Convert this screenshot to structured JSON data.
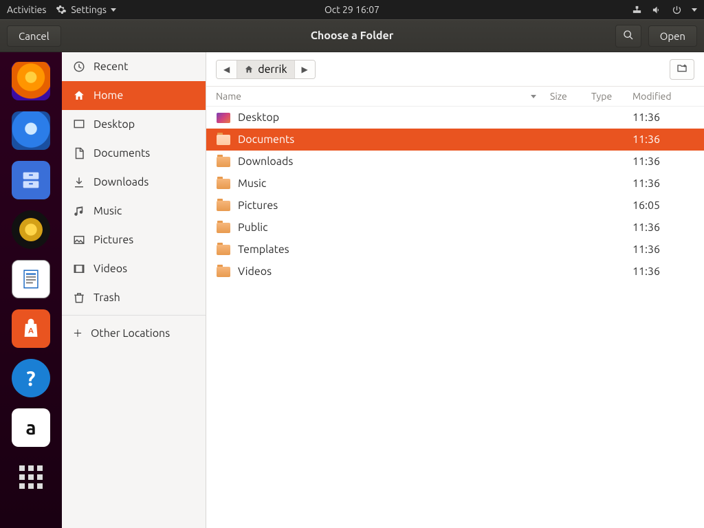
{
  "topbar": {
    "activities": "Activities",
    "appmenu": "Settings",
    "clock": "Oct 29  16:07"
  },
  "header": {
    "cancel": "Cancel",
    "title": "Choose a Folder",
    "open": "Open"
  },
  "dock": {
    "items": [
      {
        "name": "firefox",
        "color": "#2b2a33"
      },
      {
        "name": "thunderbird",
        "color": "#2b2a33"
      },
      {
        "name": "files",
        "color": "#2b6bd4"
      },
      {
        "name": "rhythmbox",
        "color": "#1b1b1b"
      },
      {
        "name": "writer",
        "color": "#ffffff"
      },
      {
        "name": "software",
        "color": "#e95420"
      },
      {
        "name": "help",
        "color": "#1a7fd4"
      },
      {
        "name": "amazon",
        "color": "#ffffff"
      },
      {
        "name": "apps",
        "color": "transparent"
      }
    ]
  },
  "sidebar": {
    "items": [
      {
        "id": "recent",
        "label": "Recent"
      },
      {
        "id": "home",
        "label": "Home"
      },
      {
        "id": "desktop",
        "label": "Desktop"
      },
      {
        "id": "documents",
        "label": "Documents"
      },
      {
        "id": "downloads",
        "label": "Downloads"
      },
      {
        "id": "music",
        "label": "Music"
      },
      {
        "id": "pictures",
        "label": "Pictures"
      },
      {
        "id": "videos",
        "label": "Videos"
      },
      {
        "id": "trash",
        "label": "Trash"
      }
    ],
    "active": "home",
    "other": "Other Locations"
  },
  "path": {
    "segments": [
      "derrik"
    ]
  },
  "columns": {
    "name": "Name",
    "size": "Size",
    "type": "Type",
    "modified": "Modified"
  },
  "files": [
    {
      "name": "Desktop",
      "modified": "11:36",
      "kind": "desktop"
    },
    {
      "name": "Documents",
      "modified": "11:36",
      "kind": "folder"
    },
    {
      "name": "Downloads",
      "modified": "11:36",
      "kind": "folder"
    },
    {
      "name": "Music",
      "modified": "11:36",
      "kind": "folder"
    },
    {
      "name": "Pictures",
      "modified": "16:05",
      "kind": "folder"
    },
    {
      "name": "Public",
      "modified": "11:36",
      "kind": "folder"
    },
    {
      "name": "Templates",
      "modified": "11:36",
      "kind": "folder"
    },
    {
      "name": "Videos",
      "modified": "11:36",
      "kind": "folder"
    }
  ],
  "selected_file": "Documents"
}
